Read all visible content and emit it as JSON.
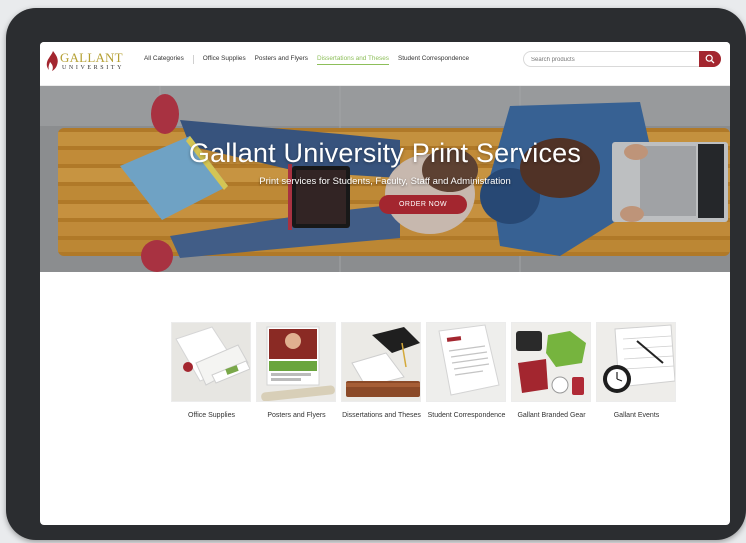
{
  "brand": {
    "name": "GALLANT",
    "subtitle": "UNIVERSITY"
  },
  "nav": {
    "items": [
      {
        "label": "All Categories",
        "active": false
      },
      {
        "label": "Office Supplies",
        "active": false
      },
      {
        "label": "Posters and Flyers",
        "active": false
      },
      {
        "label": "Dissertations and Theses",
        "active": true
      },
      {
        "label": "Student Correspondence",
        "active": false
      }
    ]
  },
  "search": {
    "placeholder": "Search products",
    "icon": "search-icon"
  },
  "hero": {
    "title": "Gallant University Print Services",
    "subtitle": "Print services for Students, Faculty, Staff and Administration",
    "cta_label": "ORDER NOW"
  },
  "categories": [
    {
      "label": "Office Supplies"
    },
    {
      "label": "Posters and Flyers"
    },
    {
      "label": "Dissertations and Theses"
    },
    {
      "label": "Student Correspondence"
    },
    {
      "label": "Gallant Branded Gear"
    },
    {
      "label": "Gallant Events"
    }
  ],
  "colors": {
    "brand_red": "#a3262f",
    "brand_gold": "#b5a034",
    "active_nav": "#8dbf5a"
  }
}
